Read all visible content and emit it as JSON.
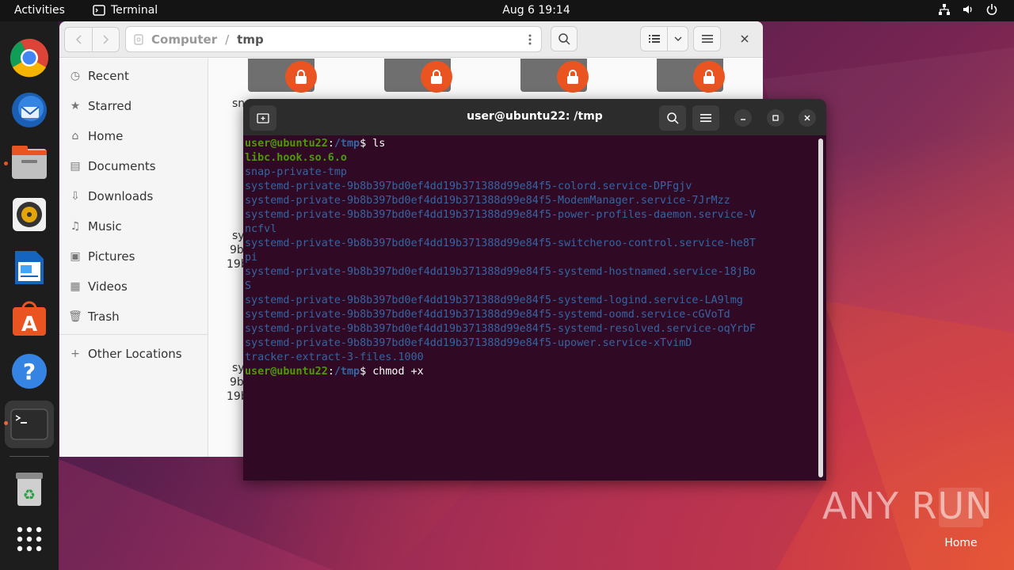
{
  "topbar": {
    "activities": "Activities",
    "app_name": "Terminal",
    "clock": "Aug 6  19:14"
  },
  "dock": {
    "items": [
      "chrome-icon",
      "thunderbird-icon",
      "files-icon",
      "rhythmbox-icon",
      "writer-icon",
      "app-center-icon",
      "help-icon",
      "terminal-icon",
      "trash-icon",
      "show-apps-icon"
    ]
  },
  "files": {
    "path_root": "Computer",
    "path_sep": "/",
    "path_current": "tmp",
    "sidebar": {
      "recent": "Recent",
      "starred": "Starred",
      "home": "Home",
      "documents": "Documents",
      "downloads": "Downloads",
      "music": "Music",
      "pictures": "Pictures",
      "videos": "Videos",
      "trash": "Trash",
      "other": "Other Locations"
    },
    "fragments": [
      "sn",
      "sy",
      "9b",
      "19b",
      "sy",
      "9b",
      "19b"
    ]
  },
  "terminal": {
    "title": "user@ubuntu22: /tmp",
    "prompt_user": "user@ubuntu22",
    "prompt_sep": ":",
    "prompt_path": "/tmp",
    "prompt_dollar": "$",
    "cmd1": " ls",
    "output": [
      {
        "text": "libc.hook.so.6.o",
        "cls": "exe"
      },
      {
        "text": "snap-private-tmp",
        "cls": "dir"
      },
      {
        "text": "systemd-private-9b8b397bd0ef4dd19b371388d99e84f5-colord.service-DPFgjv",
        "cls": "dir"
      },
      {
        "text": "systemd-private-9b8b397bd0ef4dd19b371388d99e84f5-ModemManager.service-7JrMzz",
        "cls": "dir"
      },
      {
        "text": "systemd-private-9b8b397bd0ef4dd19b371388d99e84f5-power-profiles-daemon.service-V",
        "cls": "dir"
      },
      {
        "text": "ncfvl",
        "cls": "dir"
      },
      {
        "text": "systemd-private-9b8b397bd0ef4dd19b371388d99e84f5-switcheroo-control.service-he8T",
        "cls": "dir"
      },
      {
        "text": "pi",
        "cls": "dir"
      },
      {
        "text": "systemd-private-9b8b397bd0ef4dd19b371388d99e84f5-systemd-hostnamed.service-18jBo",
        "cls": "dir"
      },
      {
        "text": "S",
        "cls": "dir"
      },
      {
        "text": "systemd-private-9b8b397bd0ef4dd19b371388d99e84f5-systemd-logind.service-LA9lmg",
        "cls": "dir"
      },
      {
        "text": "systemd-private-9b8b397bd0ef4dd19b371388d99e84f5-systemd-oomd.service-cGVoTd",
        "cls": "dir"
      },
      {
        "text": "systemd-private-9b8b397bd0ef4dd19b371388d99e84f5-systemd-resolved.service-oqYrbF",
        "cls": "dir"
      },
      {
        "text": "systemd-private-9b8b397bd0ef4dd19b371388d99e84f5-upower.service-xTvimD",
        "cls": "dir"
      },
      {
        "text": "tracker-extract-3-files.1000",
        "cls": "dir"
      }
    ],
    "cmd2": " chmod +x"
  },
  "desktop": {
    "watermark": "ANY RUN",
    "home_label": "Home"
  },
  "colors": {
    "accent": "#e95420",
    "term_bg": "#300a24",
    "prompt_green": "#4e9a06",
    "dir_blue": "#3465a4"
  }
}
